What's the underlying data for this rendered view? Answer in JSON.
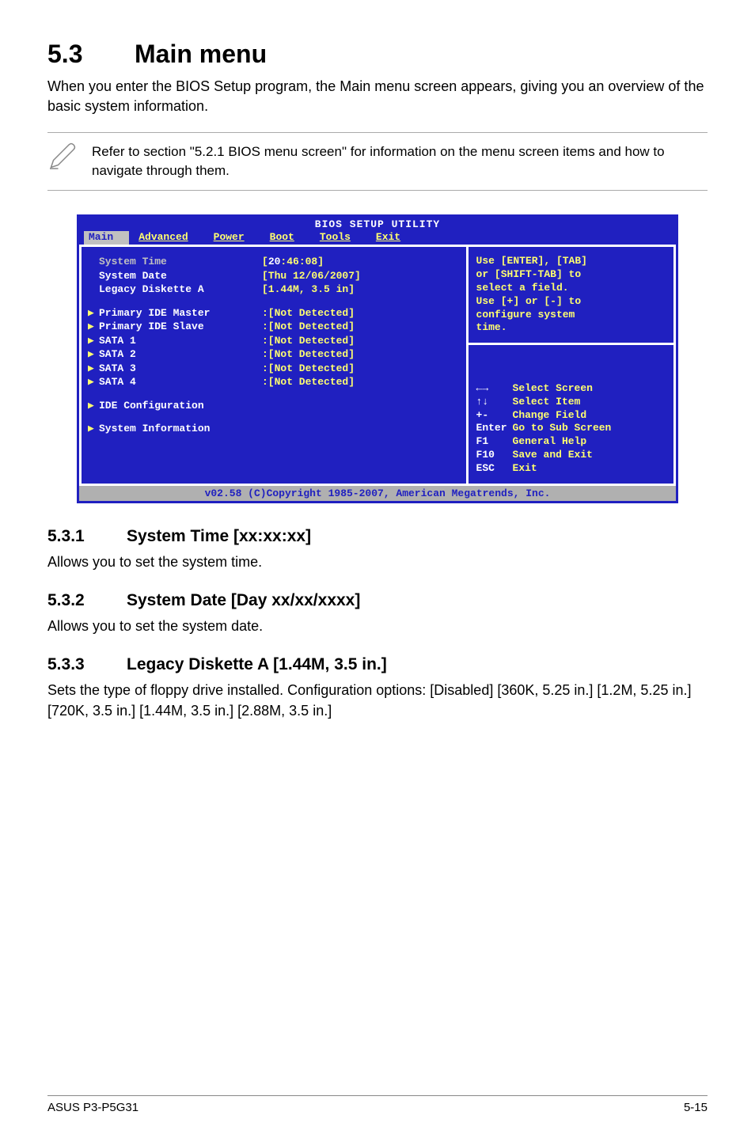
{
  "section": {
    "number": "5.3",
    "title": "Main menu"
  },
  "intro": "When you enter the BIOS Setup program, the Main menu screen appears, giving you an overview of the basic system information.",
  "note": "Refer to section \"5.2.1  BIOS menu screen\" for information on the menu screen items and how to navigate through them.",
  "bios": {
    "title": "BIOS SETUP UTILITY",
    "tabs": [
      "Main",
      "Advanced",
      "Power",
      "Boot",
      "Tools",
      "Exit"
    ],
    "active_tab": "Main",
    "rows_group1": [
      {
        "label": "System Time",
        "value_prefix": "[",
        "value_hl": "20",
        "value_suffix": ":46:08]",
        "highlight": true
      },
      {
        "label": "System Date",
        "value": "[Thu 12/06/2007]"
      },
      {
        "label": "Legacy Diskette A",
        "value": "[1.44M, 3.5 in]"
      }
    ],
    "rows_group2": [
      {
        "label": "Primary IDE Master",
        "value": ":[Not Detected]"
      },
      {
        "label": "Primary IDE Slave",
        "value": ":[Not Detected]"
      },
      {
        "label": "SATA 1",
        "value": ":[Not Detected]"
      },
      {
        "label": "SATA 2",
        "value": ":[Not Detected]"
      },
      {
        "label": "SATA 3",
        "value": ":[Not Detected]"
      },
      {
        "label": "SATA 4",
        "value": ":[Not Detected]"
      }
    ],
    "rows_group3": [
      {
        "label": "IDE Configuration"
      },
      {
        "label": "System Information"
      }
    ],
    "help_top": [
      "Use [ENTER], [TAB]",
      "or [SHIFT-TAB] to",
      "select a field.",
      "",
      "Use [+] or [-] to",
      "configure system",
      "time."
    ],
    "help_bot": [
      {
        "glyph": "←→",
        "text": "Select Screen"
      },
      {
        "glyph": "↑↓",
        "text": "Select Item"
      },
      {
        "glyph": "+-",
        "text": "Change Field"
      },
      {
        "glyph": "Enter",
        "text": "Go to Sub Screen"
      },
      {
        "glyph": "F1",
        "text": "General Help"
      },
      {
        "glyph": "F10",
        "text": "Save and Exit"
      },
      {
        "glyph": "ESC",
        "text": "Exit"
      }
    ],
    "footer": "v02.58 (C)Copyright 1985-2007, American Megatrends, Inc."
  },
  "subsections": [
    {
      "num": "5.3.1",
      "title": "System Time [xx:xx:xx]",
      "desc": "Allows you to set the system time."
    },
    {
      "num": "5.3.2",
      "title": "System Date [Day xx/xx/xxxx]",
      "desc": "Allows you to set the system date."
    },
    {
      "num": "5.3.3",
      "title": "Legacy Diskette A [1.44M, 3.5 in.]",
      "desc": "Sets the type of floppy drive installed. Configuration options: [Disabled] [360K, 5.25 in.] [1.2M, 5.25 in.] [720K, 3.5 in.] [1.44M, 3.5 in.] [2.88M, 3.5 in.]"
    }
  ],
  "footer": {
    "model": "ASUS P3-P5G31",
    "page": "5-15"
  }
}
